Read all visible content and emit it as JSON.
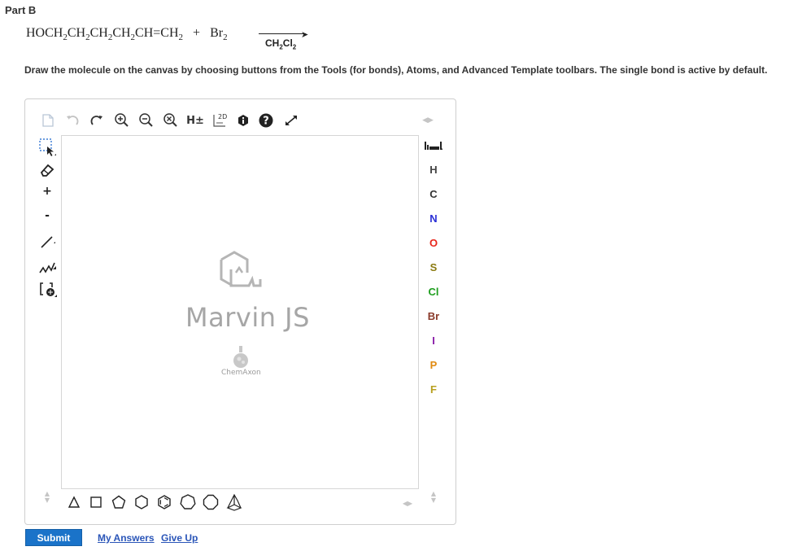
{
  "part_title": "Part B",
  "reaction": {
    "reactant1": {
      "p1": "HOCH",
      "s1": "2",
      "p2": "CH",
      "s2": "2",
      "p3": "CH",
      "s3": "2",
      "p4": "CH",
      "s4": "2",
      "p5": "CH=CH",
      "s5": "2"
    },
    "plus": "+",
    "reactant2": {
      "p1": "Br",
      "s1": "2"
    },
    "solvent": {
      "p1": "CH",
      "s1": "2",
      "p2": "Cl",
      "s2": "2"
    }
  },
  "instructions": "Draw the molecule on the canvas by choosing buttons from the Tools (for bonds), Atoms, and Advanced Template toolbars. The single bond is active by default.",
  "editor": {
    "top_toolbar": {
      "hydrogen_label": "H±",
      "clean2d_label": "2D",
      "help_label": "?"
    },
    "left_toolbar": {
      "charge_plus": "+",
      "charge_minus": "-"
    },
    "atoms": [
      {
        "symbol": "H",
        "color": "#444444"
      },
      {
        "symbol": "C",
        "color": "#333333"
      },
      {
        "symbol": "N",
        "color": "#2a2fd6"
      },
      {
        "symbol": "O",
        "color": "#e8261b"
      },
      {
        "symbol": "S",
        "color": "#8b7a10"
      },
      {
        "symbol": "Cl",
        "color": "#1e9e1e"
      },
      {
        "symbol": "Br",
        "color": "#8a3a2a"
      },
      {
        "symbol": "I",
        "color": "#8a1ea8"
      },
      {
        "symbol": "P",
        "color": "#e08a10"
      },
      {
        "symbol": "F",
        "color": "#b8a020"
      }
    ],
    "logo_text": "Marvin JS",
    "logo_sub": "ChemAxon"
  },
  "actions": {
    "submit": "Submit",
    "my_answers": "My Answers",
    "give_up": "Give Up"
  },
  "colors": {
    "submit_bg": "#1a73c9",
    "link": "#2a55b8"
  }
}
